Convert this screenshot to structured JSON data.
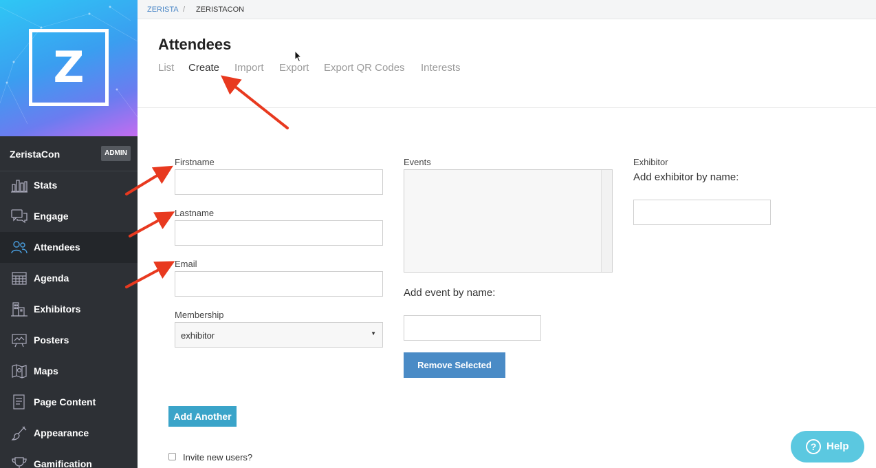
{
  "breadcrumb": {
    "items": [
      "ZERISTA",
      "ZERISTACON"
    ],
    "separator": "/"
  },
  "logo": {
    "letter": "Z"
  },
  "org": {
    "name": "ZeristaCon",
    "badge": "ADMIN"
  },
  "sidebar": {
    "items": [
      {
        "label": "Stats",
        "icon": "bar-chart-icon"
      },
      {
        "label": "Engage",
        "icon": "chat-bubbles-icon"
      },
      {
        "label": "Attendees",
        "icon": "people-icon",
        "active": true
      },
      {
        "label": "Agenda",
        "icon": "calendar-grid-icon"
      },
      {
        "label": "Exhibitors",
        "icon": "buildings-icon"
      },
      {
        "label": "Posters",
        "icon": "presentation-board-icon"
      },
      {
        "label": "Maps",
        "icon": "map-icon"
      },
      {
        "label": "Page Content",
        "icon": "document-icon"
      },
      {
        "label": "Appearance",
        "icon": "paintbrush-icon"
      },
      {
        "label": "Gamification",
        "icon": "trophy-icon"
      }
    ]
  },
  "header": {
    "title": "Attendees",
    "tabs": [
      "List",
      "Create",
      "Import",
      "Export",
      "Export QR Codes",
      "Interests"
    ],
    "active_tab": "Create"
  },
  "form": {
    "firstname_label": "Firstname",
    "lastname_label": "Lastname",
    "email_label": "Email",
    "membership_label": "Membership",
    "membership_value": "exhibitor",
    "events_label": "Events",
    "add_event_label": "Add event by name:",
    "remove_selected": "Remove Selected",
    "exhibitor_label": "Exhibitor",
    "add_exhibitor_label": "Add exhibitor by name:",
    "add_another": "Add Another",
    "invite_label": "Invite new users?"
  },
  "help": {
    "label": "Help",
    "icon": "question-circle-icon"
  },
  "colors": {
    "sidebar_bg": "#2d3035",
    "accent_blue": "#4a8bc6",
    "add_button": "#3aa4c9",
    "help_button": "#5bc8e0",
    "annotation_arrow": "#e8391f"
  }
}
